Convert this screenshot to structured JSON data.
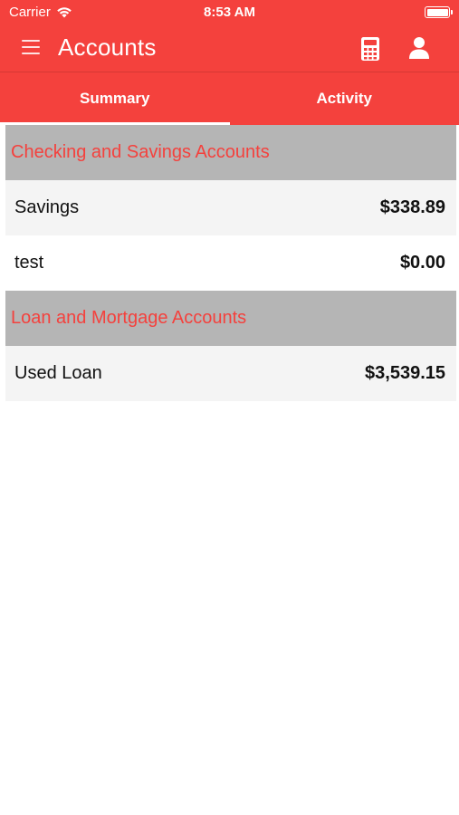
{
  "status_bar": {
    "carrier": "Carrier",
    "time": "8:53 AM"
  },
  "header": {
    "title": "Accounts",
    "icons": [
      "menu-icon",
      "calculator-icon",
      "person-icon"
    ]
  },
  "tabs": [
    {
      "label": "Summary",
      "active": true
    },
    {
      "label": "Activity",
      "active": false
    }
  ],
  "sections": [
    {
      "title": "Checking and Savings Accounts",
      "accounts": [
        {
          "name": "Savings",
          "amount": "$338.89"
        },
        {
          "name": "test",
          "amount": "$0.00"
        }
      ]
    },
    {
      "title": "Loan and Mortgage Accounts",
      "accounts": [
        {
          "name": "Used Loan",
          "amount": "$3,539.15"
        }
      ]
    }
  ],
  "colors": {
    "brand": "#f4413d",
    "section_header_bg": "#b5b5b5",
    "row_alt_bg": "#f4f4f4"
  }
}
